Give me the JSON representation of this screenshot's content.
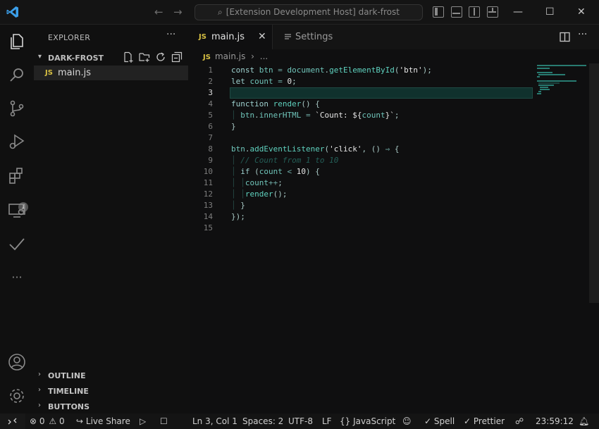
{
  "titlebar": {
    "search_text": "[Extension Development Host] dark-frost"
  },
  "sidebar": {
    "title": "EXPLORER",
    "more": "···",
    "folder": "DARK-FROST",
    "files": [
      {
        "badge": "JS",
        "name": "main.js"
      }
    ],
    "bottom_sections": [
      "OUTLINE",
      "TIMELINE",
      "BUTTONS"
    ]
  },
  "activity": {
    "extensions_badge": "1"
  },
  "tabs": [
    {
      "badge": "JS",
      "label": "main.js",
      "close": "✕"
    },
    {
      "label": "Settings"
    }
  ],
  "breadcrumb": {
    "badge": "JS",
    "file": "main.js",
    "separator": "›",
    "rest": "..."
  },
  "editor": {
    "current_line": 3,
    "line_numbers": [
      "1",
      "2",
      "3",
      "4",
      "5",
      "6",
      "7",
      "8",
      "9",
      "10",
      "11",
      "12",
      "13",
      "14",
      "15"
    ]
  },
  "statusbar": {
    "errors": "0",
    "warnings": "0",
    "live_share": "Live Share",
    "cursor": "Ln 3, Col 1",
    "spaces": "Spaces: 2",
    "encoding": "UTF-8",
    "eol": "LF",
    "language": "JavaScript",
    "spell": "Spell",
    "prettier": "Prettier",
    "time": "23:59:12"
  },
  "colors": {
    "accent": "#5fd2bf",
    "current_line_bg": "#10312d",
    "js_badge": "#d7c043"
  },
  "icons": [
    "vscode-logo-icon",
    "arrow-left-icon",
    "arrow-right-icon",
    "search-icon",
    "toggle-sidebar-icon",
    "toggle-panel-icon",
    "toggle-secondary-sidebar-icon",
    "customize-layout-icon",
    "minimize-icon",
    "maximize-icon",
    "close-icon",
    "files-icon",
    "search-icon",
    "source-control-icon",
    "run-debug-icon",
    "extensions-icon",
    "remote-explorer-icon",
    "testing-icon",
    "more-icon",
    "accounts-icon",
    "manage-gear-icon",
    "new-file-icon",
    "new-folder-icon",
    "refresh-icon",
    "collapse-all-icon",
    "split-editor-icon",
    "remote-icon",
    "error-icon",
    "warning-icon",
    "live-share-icon",
    "run-icon",
    "stop-icon",
    "braces-icon",
    "copilot-icon",
    "spell-check-icon",
    "check-all-icon",
    "feedback-icon",
    "bell-icon"
  ]
}
